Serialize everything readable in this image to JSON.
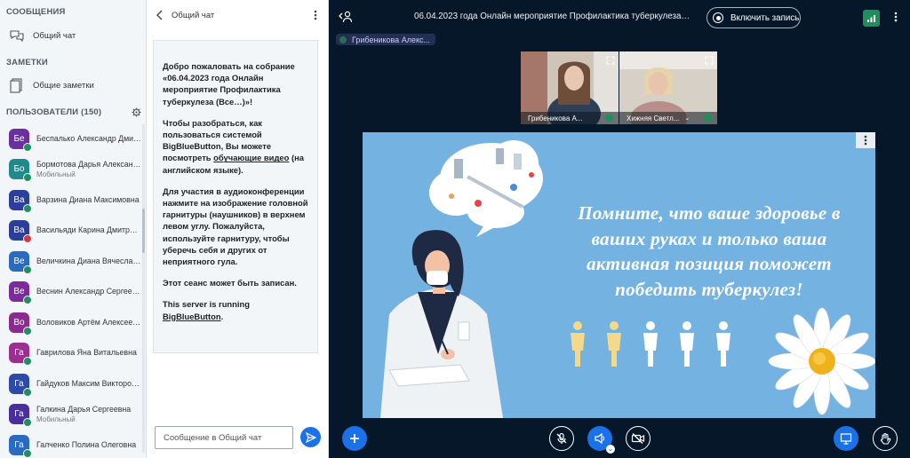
{
  "sidebar": {
    "messages_title": "СООБЩЕНИЯ",
    "public_chat": "Общий чат",
    "notes_title": "ЗАМЕТКИ",
    "shared_notes": "Общие заметки",
    "users_title": "ПОЛЬЗОВАТЕЛИ (150)",
    "users": [
      {
        "initials": "Бе",
        "name": "Беспалько Александр Дмитри...",
        "sub": "",
        "color": "#6a2fa0",
        "mic": "#1f8f63"
      },
      {
        "initials": "Бо",
        "name": "Бормотова Дарья Александро...",
        "sub": "Мобильный",
        "color": "#1f8a8a",
        "mic": "#1f8f63"
      },
      {
        "initials": "Ва",
        "name": "Варзина Диана Максимовна",
        "sub": "",
        "color": "#2c3e9c",
        "mic": "#1f8f63"
      },
      {
        "initials": "Ва",
        "name": "Васильяди Карина Дмитриевна",
        "sub": "",
        "color": "#2c3e9c",
        "mic": "#d23a3a"
      },
      {
        "initials": "Ве",
        "name": "Величкина Диана Вячеславовна",
        "sub": "",
        "color": "#2a6ac0",
        "mic": "#1f8f63"
      },
      {
        "initials": "Ве",
        "name": "Веснин Александр Сергеевич",
        "sub": "",
        "color": "#7b2b9c",
        "mic": "#1f8f63"
      },
      {
        "initials": "Во",
        "name": "Воловиков Артём Алексеевич",
        "sub": "",
        "color": "#8a2b8f",
        "mic": "#1f8f63"
      },
      {
        "initials": "Га",
        "name": "Гаврилова Яна Витальевна",
        "sub": "",
        "color": "#9a2f8f",
        "mic": "#1f8f63"
      },
      {
        "initials": "Га",
        "name": "Гайдуков Максим Викторович",
        "sub": "",
        "color": "#2c4aa8",
        "mic": "#1f8f63"
      },
      {
        "initials": "Га",
        "name": "Галкина Дарья Сергеевна",
        "sub": "Мобильный",
        "color": "#4a2e9c",
        "mic": "#1f8f63"
      },
      {
        "initials": "Га",
        "name": "Галченко Полина Олеговна",
        "sub": "",
        "color": "#2a6ac0",
        "mic": "#1f8f63"
      }
    ]
  },
  "chat": {
    "title": "Общий чат",
    "welcome": {
      "p1_a": "Добро пожаловать на собрание «",
      "p1_b": "06.04.2023 года Онлайн мероприятие Профилактика туберкулеза (Все…)",
      "p1_c": "»!",
      "p2_a": "Чтобы разобраться, как пользоваться системой BigBlueButton, ",
      "p2_b": "Вы можете посмотреть ",
      "p2_link": "обучающие видео",
      "p2_c": " (на английском языке).",
      "p3_a": "Для участия в аудиоконференции нажмите на изображение головной гарнитуры (наушников) в верхнем левом углу. ",
      "p3_b": "Пожалуйста, используйте гарнитуру, чтобы уберечь себя и других от неприятного гула.",
      "p4": "Этот сеанс может быть записан.",
      "p5_a": "This server is running ",
      "p5_link": "BigBlueButton",
      "p5_b": "."
    },
    "input_placeholder": "Сообщение в Общий чат"
  },
  "main": {
    "meeting_title": "06.04.2023 года Онлайн мероприятие Профилактика туберкулеза (В...",
    "record_label": "Включить запись",
    "presenter": "Грибеникова Алекс...",
    "cams": [
      {
        "name": "Грибеникова А..."
      },
      {
        "name": "Хижняя Светл..."
      }
    ],
    "slide_text": "Помните, что ваше здоровье в ваших руках и только ваша активная позиция поможет победить туберкулез!"
  }
}
